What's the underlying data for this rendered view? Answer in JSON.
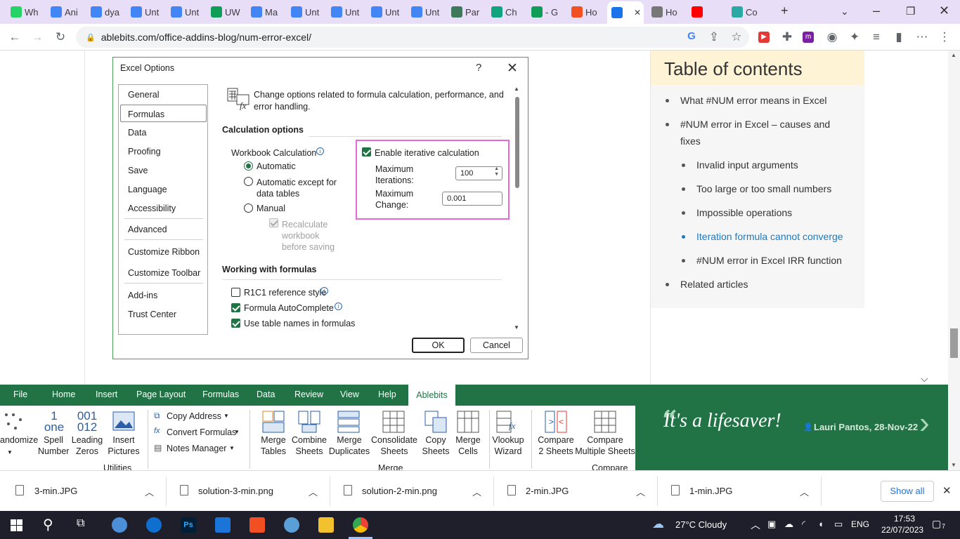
{
  "browser": {
    "tabs": [
      {
        "label": "Wh",
        "color": "#25d366"
      },
      {
        "label": "Ani",
        "color": "#4285f4"
      },
      {
        "label": "dya",
        "color": "#4285f4"
      },
      {
        "label": "Unt",
        "color": "#4285f4"
      },
      {
        "label": "Unt",
        "color": "#4285f4"
      },
      {
        "label": "UW",
        "color": "#0f9d58"
      },
      {
        "label": "Ma",
        "color": "#4285f4"
      },
      {
        "label": "Unt",
        "color": "#4285f4"
      },
      {
        "label": "Unt",
        "color": "#4285f4"
      },
      {
        "label": "Unt",
        "color": "#4285f4"
      },
      {
        "label": "Unt",
        "color": "#4285f4"
      },
      {
        "label": "Par",
        "color": "#3d7a5c"
      },
      {
        "label": "Ch",
        "color": "#10a37f"
      },
      {
        "label": "- G",
        "color": "#0f9d58"
      },
      {
        "label": "Ho",
        "color": "#f25022"
      },
      {
        "label": "",
        "color": "#1a73e8"
      },
      {
        "label": "Ho",
        "color": "#777"
      },
      {
        "label": "",
        "color": "#ff0000"
      },
      {
        "label": "Co",
        "color": "#2aa8a4"
      }
    ],
    "url": "ablebits.com/office-addins-blog/num-error-excel/"
  },
  "dialog": {
    "title": "Excel Options",
    "help": "?",
    "categories": [
      "General",
      "Formulas",
      "Data",
      "Proofing",
      "Save",
      "Language",
      "Accessibility",
      "Advanced",
      "Customize Ribbon",
      "Customize Toolbar",
      "Add-ins",
      "Trust Center"
    ],
    "header": "Change options related to formula calculation, performance, and error handling.",
    "calc_section": "Calculation options",
    "workbook_calc": "Workbook Calculation",
    "automatic": "Automatic",
    "auto_except": "Automatic except for data tables",
    "manual": "Manual",
    "recalc": "Recalculate workbook before saving",
    "enable_iter": "Enable iterative calculation",
    "max_iter_label": "Maximum Iterations:",
    "max_iter_value": "100",
    "max_change_label": "Maximum Change:",
    "max_change_value": "0.001",
    "formulas_section": "Working with formulas",
    "r1c1": "R1C1 reference style",
    "autocomplete": "Formula AutoComplete",
    "table_names": "Use table names in formulas",
    "ok": "OK",
    "cancel": "Cancel"
  },
  "toc": {
    "title": "Table of contents",
    "items": [
      "What #NUM error means in Excel",
      "#NUM error in Excel – causes and fixes",
      "Invalid input arguments",
      "Too large or too small numbers",
      "Impossible operations",
      "Iteration formula cannot converge",
      "#NUM error in Excel IRR function",
      "Related articles"
    ]
  },
  "ribbon": {
    "tabs": [
      "File",
      "Home",
      "Insert",
      "Page Layout",
      "Formulas",
      "Data",
      "Review",
      "View",
      "Help"
    ],
    "active_tab": "Ablebits",
    "randomize": "andomize",
    "spell_number": "Spell Number",
    "spell_icon": "1 one",
    "leading_zeros": "Leading Zeros",
    "leading_icon": "001 012",
    "insert_pictures": "Insert Pictures",
    "copy_address": "Copy Address",
    "convert_formulas": "Convert Formulas",
    "notes_manager": "Notes Manager",
    "merge_tables": "Merge Tables",
    "combine_sheets": "Combine Sheets",
    "merge_duplicates": "Merge Duplicates",
    "consolidate_sheets": "Consolidate Sheets",
    "copy_sheets": "Copy Sheets",
    "merge_cells": "Merge Cells",
    "vlookup_wizard": "Vlookup Wizard",
    "compare_2_sheets": "Compare 2 Sheets",
    "compare_multiple": "Compare Multiple Sheets",
    "group_utilities": "Utilities",
    "group_merge": "Merge",
    "group_compare": "Compare",
    "quote": "It's a lifesaver!",
    "quote_by": "Lauri Pantos, 28-Nov-22"
  },
  "downloads": {
    "files": [
      "3-min.JPG",
      "solution-3-min.png",
      "solution-2-min.png",
      "2-min.JPG",
      "1-min.JPG"
    ],
    "show_all": "Show all"
  },
  "taskbar": {
    "weather": "27°C  Cloudy",
    "lang": "ENG",
    "time": "17:53",
    "date": "22/07/2023",
    "notif_count": "7"
  }
}
